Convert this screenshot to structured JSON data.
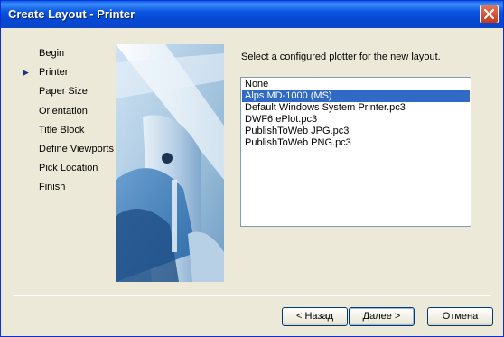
{
  "window": {
    "title": "Create Layout - Printer"
  },
  "steps": [
    {
      "label": "Begin",
      "active": false
    },
    {
      "label": "Printer",
      "active": true
    },
    {
      "label": "Paper Size",
      "active": false
    },
    {
      "label": "Orientation",
      "active": false
    },
    {
      "label": "Title Block",
      "active": false
    },
    {
      "label": "Define Viewports",
      "active": false
    },
    {
      "label": "Pick Location",
      "active": false
    },
    {
      "label": "Finish",
      "active": false
    }
  ],
  "main": {
    "prompt": "Select a configured plotter for the new layout.",
    "plotters": [
      {
        "label": "None",
        "selected": false
      },
      {
        "label": "Alps MD-1000 (MS)",
        "selected": true
      },
      {
        "label": "Default Windows System Printer.pc3",
        "selected": false
      },
      {
        "label": "DWF6 ePlot.pc3",
        "selected": false
      },
      {
        "label": "PublishToWeb JPG.pc3",
        "selected": false
      },
      {
        "label": "PublishToWeb PNG.pc3",
        "selected": false
      }
    ]
  },
  "buttons": {
    "back": "< Назад",
    "next": "Далее >",
    "cancel": "Отмена"
  },
  "icons": {
    "close": "close-icon",
    "current_step": "current-step-arrow-icon"
  },
  "colors": {
    "titlebar": "#0a55e0",
    "dialog_bg": "#ece9d8",
    "selection": "#316ac5",
    "close_button": "#c8391b"
  }
}
